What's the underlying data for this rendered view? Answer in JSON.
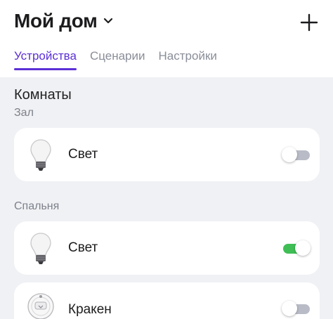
{
  "header": {
    "home_title": "Мой дом",
    "add_icon": "plus-icon",
    "chevron_icon": "chevron-down-icon"
  },
  "tabs": [
    {
      "label": "Устройства",
      "active": true
    },
    {
      "label": "Сценарии",
      "active": false
    },
    {
      "label": "Настройки",
      "active": false
    }
  ],
  "section_title": "Комнаты",
  "rooms": [
    {
      "name": "Зал",
      "devices": [
        {
          "name": "Свет",
          "icon": "light-bulb-icon",
          "on": false
        }
      ]
    },
    {
      "name": "Спальня",
      "devices": [
        {
          "name": "Свет",
          "icon": "light-bulb-icon",
          "on": true
        },
        {
          "name": "Кракен",
          "icon": "robot-vacuum-icon",
          "on": false
        }
      ]
    }
  ],
  "colors": {
    "accent": "#5b2fd6",
    "toggle_on": "#3fbe55",
    "toggle_off": "#b9bcc7",
    "background": "#f0f1f4"
  }
}
